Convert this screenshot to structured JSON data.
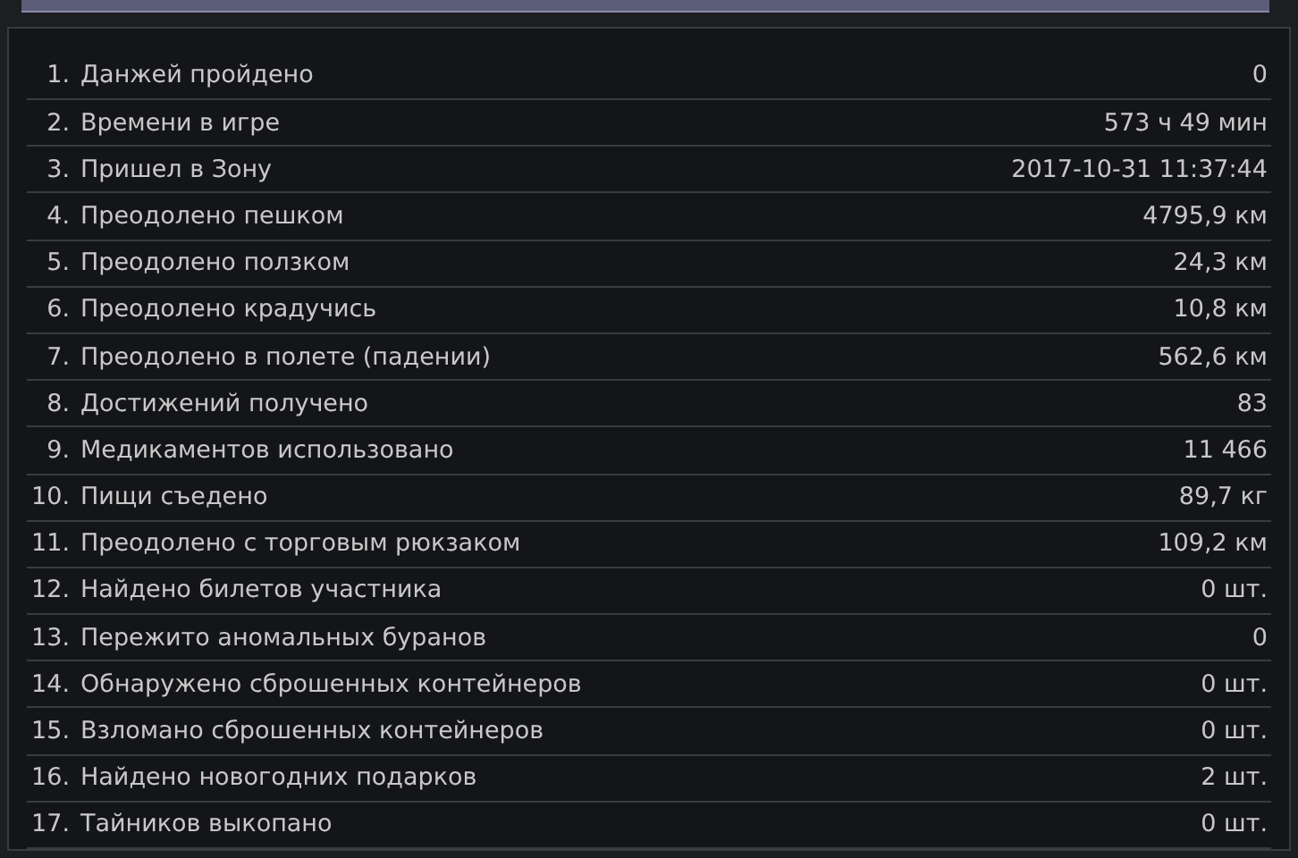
{
  "stats": [
    {
      "index": "1.",
      "label": "Данжей пройдено",
      "value": "0"
    },
    {
      "index": "2.",
      "label": "Времени в игре",
      "value": "573 ч 49 мин"
    },
    {
      "index": "3.",
      "label": "Пришел в Зону",
      "value": "2017-10-31 11:37:44"
    },
    {
      "index": "4.",
      "label": "Преодолено пешком",
      "value": "4795,9 км"
    },
    {
      "index": "5.",
      "label": "Преодолено ползком",
      "value": "24,3 км"
    },
    {
      "index": "6.",
      "label": "Преодолено крадучись",
      "value": "10,8 км"
    },
    {
      "index": "7.",
      "label": "Преодолено в полете (падении)",
      "value": "562,6 км"
    },
    {
      "index": "8.",
      "label": "Достижений получено",
      "value": "83"
    },
    {
      "index": "9.",
      "label": "Медикаментов использовано",
      "value": "11 466"
    },
    {
      "index": "10.",
      "label": "Пищи съедено",
      "value": "89,7 кг"
    },
    {
      "index": "11.",
      "label": "Преодолено с торговым рюкзаком",
      "value": "109,2 км"
    },
    {
      "index": "12.",
      "label": "Найдено билетов участника",
      "value": "0 шт."
    },
    {
      "index": "13.",
      "label": "Пережито аномальных буранов",
      "value": "0"
    },
    {
      "index": "14.",
      "label": "Обнаружено сброшенных контейнеров",
      "value": "0 шт."
    },
    {
      "index": "15.",
      "label": "Взломано сброшенных контейнеров",
      "value": "0 шт."
    },
    {
      "index": "16.",
      "label": "Найдено новогодних подарков",
      "value": "2 шт."
    },
    {
      "index": "17.",
      "label": "Тайников выкопано",
      "value": "0 шт."
    }
  ]
}
